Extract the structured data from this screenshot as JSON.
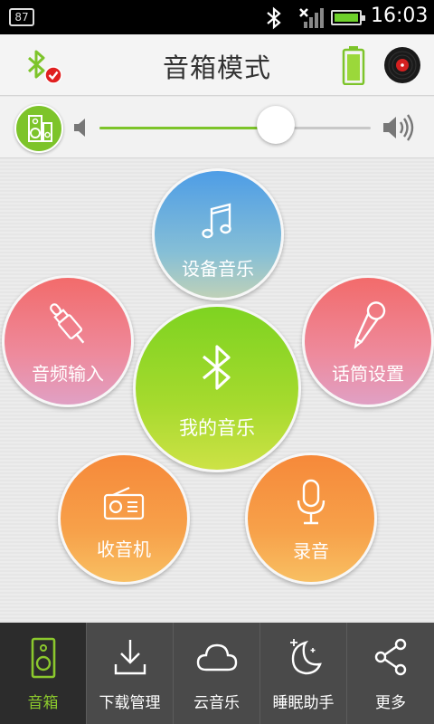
{
  "status_bar": {
    "notification_count": "87",
    "time": "16:03"
  },
  "header": {
    "title": "音箱模式",
    "bluetooth_icon": "bluetooth-connected-icon",
    "battery_icon": "battery-icon",
    "disc_icon": "vinyl-disc-icon"
  },
  "volume": {
    "level": 0.65,
    "speaker_icon": "speaker-icon"
  },
  "modes": {
    "device_music": "设备音乐",
    "audio_input": "音频输入",
    "mic_settings": "话筒设置",
    "my_music": "我的音乐",
    "radio": "收音机",
    "record": "录音"
  },
  "nav": {
    "items": [
      {
        "label": "音箱",
        "icon": "speaker-icon",
        "active": true
      },
      {
        "label": "下载管理",
        "icon": "download-icon",
        "active": false
      },
      {
        "label": "云音乐",
        "icon": "cloud-icon",
        "active": false
      },
      {
        "label": "睡眠助手",
        "icon": "moon-icon",
        "active": false
      },
      {
        "label": "更多",
        "icon": "share-icon",
        "active": false
      }
    ]
  },
  "colors": {
    "accent_green": "#7dc42a",
    "device_blue": "#4e9de6",
    "pink": "#f26b6b",
    "orange": "#f6893a"
  }
}
